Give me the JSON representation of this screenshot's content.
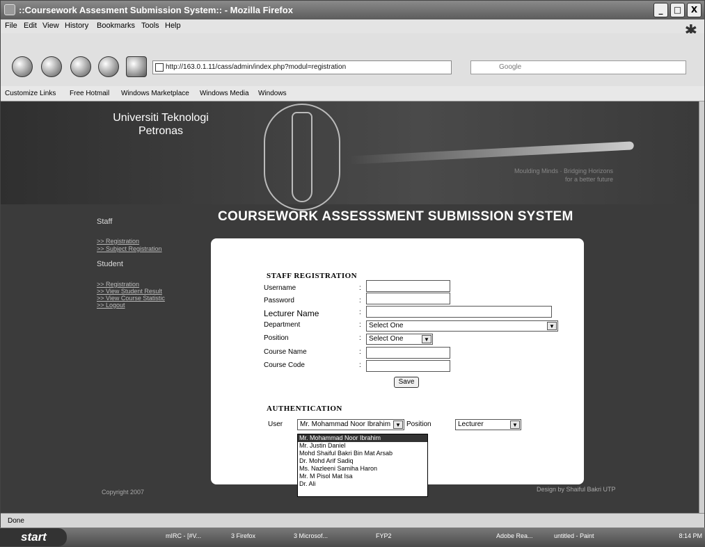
{
  "window": {
    "title": "::Coursework Assesment Submission System:: - Mozilla Firefox",
    "controls": [
      "_",
      "□",
      "X"
    ]
  },
  "menu": [
    "File",
    "Edit",
    "View",
    "History",
    "Bookmarks",
    "Tools",
    "Help"
  ],
  "nav": {
    "url": "http://163.0.1.11/cass/admin/index.php?modul=registration",
    "search_placeholder": "Google"
  },
  "bookmarks": [
    "Customize Links",
    "Free Hotmail",
    "Windows Marketplace",
    "Windows Media",
    "Windows"
  ],
  "page": {
    "university": "Universiti Teknologi\nPetronas",
    "motto": "Moulding Minds · Bridging Horizons\nfor a better future",
    "system_title": "COURSEWORK ASSESSSMENT SUBMISSION SYSTEM",
    "sidebar": {
      "staff_heading": "Staff",
      "staff_links": [
        ">> Registration",
        ">> Subject Registration"
      ],
      "student_heading": "Student",
      "student_links": [
        ">> Registration",
        ">> View Student Result",
        ">> View Course Statistic",
        ">> Logout"
      ]
    },
    "staff_registration": {
      "heading": "STAFF REGISTRATION",
      "fields": [
        {
          "label": "Username",
          "type": "text",
          "value": ""
        },
        {
          "label": "Password",
          "type": "text",
          "value": ""
        },
        {
          "label": "Lecturer Name",
          "type": "text",
          "value": ""
        },
        {
          "label": "Department",
          "type": "select",
          "value": "Select One"
        },
        {
          "label": "Position",
          "type": "select",
          "value": "Select One"
        },
        {
          "label": "Course Name",
          "type": "text",
          "value": ""
        },
        {
          "label": "Course Code",
          "type": "text",
          "value": ""
        }
      ],
      "save_label": "Save"
    },
    "authentication": {
      "heading": "AUTHENTICATION",
      "user_label": "User",
      "user_value": "Mr. Mohammad Noor Ibrahim",
      "position_label": "Position",
      "position_value": "Lecturer",
      "user_options": [
        "Mr. Mohammad Noor Ibrahim",
        "Mr. Justin Daniel",
        "Mohd Shaiful Bakri Bin Mat Arsab",
        "Dr. Mohd Arif Sadiq",
        "Ms. Nazleeni Samiha Haron",
        "Mr. M Pisol Mat Isa",
        "Dr. Ali"
      ]
    },
    "copyright": "Copyright 2007",
    "designer": "Design by Shaiful Bakri UTP"
  },
  "status": "Done",
  "taskbar": {
    "start": "start",
    "items": [
      "mIRC - [#V...",
      "3 Firefox",
      "3 Microsof...",
      "FYP2",
      "Adobe Rea...",
      "untitled - Paint"
    ],
    "clock": "8:14 PM"
  },
  "colors": {
    "page_bg": "#3b3b3b",
    "panel_bg": "#ffffff",
    "title": "#ffffff"
  }
}
